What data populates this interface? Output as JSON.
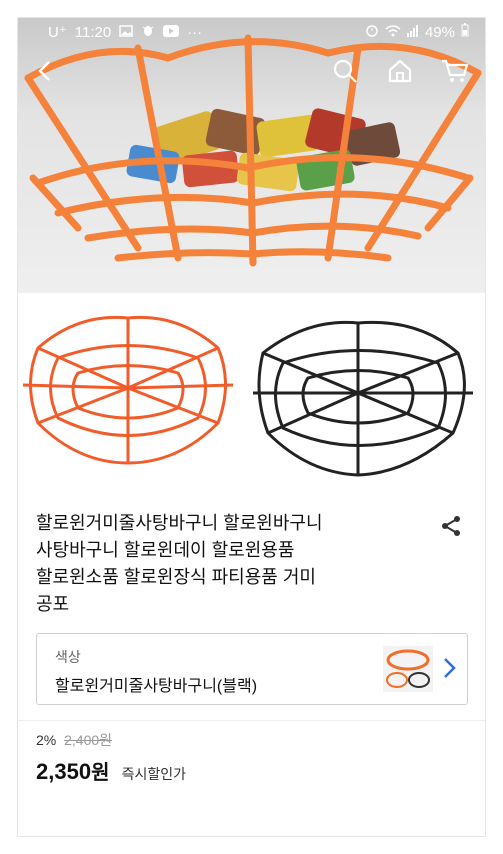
{
  "status": {
    "carrier": "U⁺",
    "time": "11:20",
    "battery": "49%",
    "dots": "···"
  },
  "nav": {
    "back_icon": "back-arrow-icon",
    "search_icon": "search-icon",
    "home_icon": "home-icon",
    "cart_icon": "cart-icon"
  },
  "product": {
    "title_lines": [
      "할로윈거미줄사탕바구니 할로윈바구니",
      "사탕바구니 할로윈데이 할로윈용품",
      "할로윈소품 할로윈장식 파티용품 거미",
      "공포"
    ]
  },
  "option": {
    "label": "색상",
    "value": "할로윈거미줄사탕바구니(블랙)"
  },
  "price": {
    "discount_rate": "2%",
    "original": "2,400원",
    "current": "2,350",
    "unit": "원",
    "tag": "즉시할인가"
  },
  "colors": {
    "orange": "#f26d2c",
    "black": "#222222",
    "accent": "#2f6fd8"
  }
}
